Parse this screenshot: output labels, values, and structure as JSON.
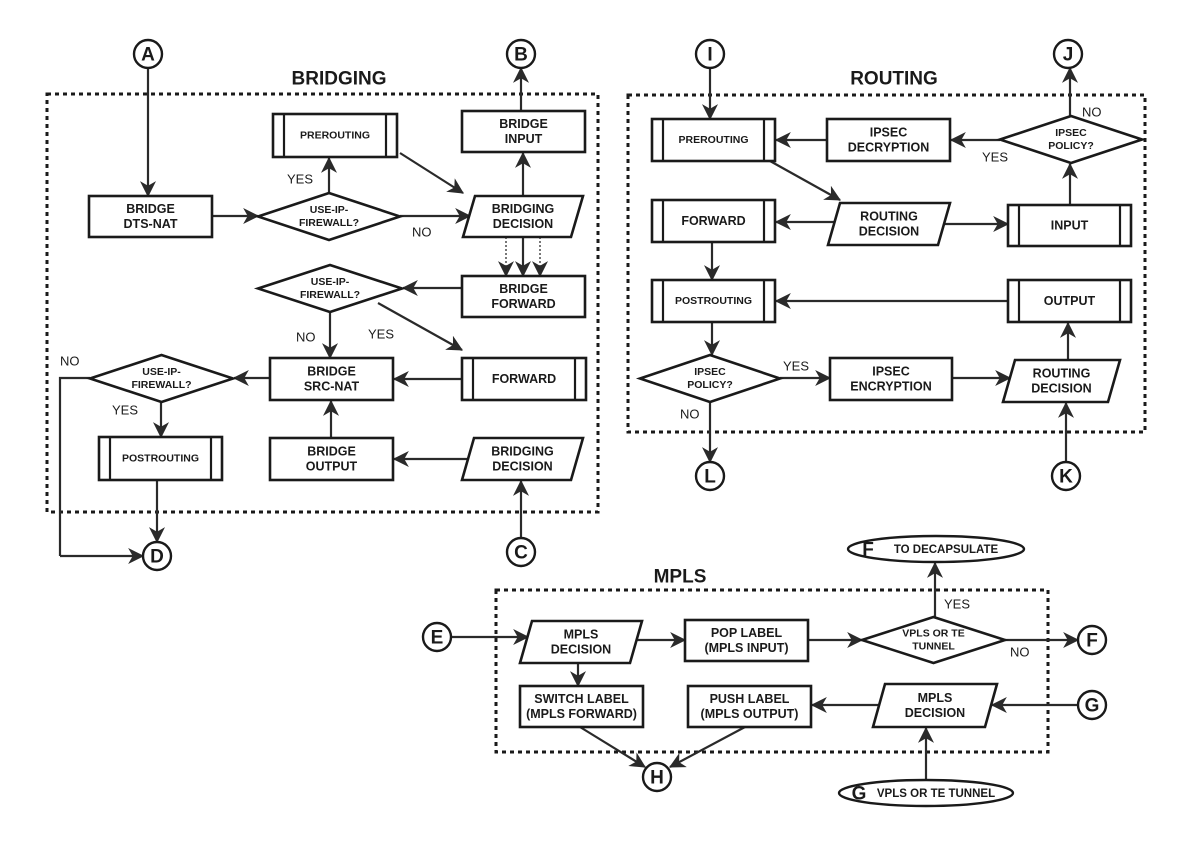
{
  "colors": {
    "ink": "#1a1a1a",
    "background": "#ffffff"
  },
  "groups": [
    {
      "id": "bridging",
      "title": "BRIDGING"
    },
    {
      "id": "routing",
      "title": "ROUTING"
    },
    {
      "id": "mpls",
      "title": "MPLS"
    }
  ],
  "connectors": [
    {
      "id": "A",
      "label": "A"
    },
    {
      "id": "B",
      "label": "B"
    },
    {
      "id": "C",
      "label": "C"
    },
    {
      "id": "D",
      "label": "D"
    },
    {
      "id": "E",
      "label": "E"
    },
    {
      "id": "F",
      "label": "F"
    },
    {
      "id": "G",
      "label": "G"
    },
    {
      "id": "H",
      "label": "H"
    },
    {
      "id": "I",
      "label": "I"
    },
    {
      "id": "J",
      "label": "J"
    },
    {
      "id": "K",
      "label": "K"
    },
    {
      "id": "L",
      "label": "L"
    }
  ],
  "terminators": [
    {
      "id": "f-decap",
      "letter": "F",
      "text": "TO DECAPSULATE"
    },
    {
      "id": "g-vpls",
      "letter": "G",
      "text": "VPLS OR TE TUNNEL"
    }
  ],
  "nodes": [
    {
      "id": "b-dtsnat",
      "group": "bridging",
      "shape": "process",
      "lines": [
        "BRIDGE",
        "DTS-NAT"
      ]
    },
    {
      "id": "b-fw1",
      "group": "bridging",
      "shape": "decision",
      "lines": [
        "USE-IP-",
        "FIREWALL?"
      ]
    },
    {
      "id": "b-prerouting",
      "group": "bridging",
      "shape": "subprocess",
      "lines": [
        "PREROUTING"
      ]
    },
    {
      "id": "b-input",
      "group": "bridging",
      "shape": "process",
      "lines": [
        "BRIDGE",
        "INPUT"
      ]
    },
    {
      "id": "b-decision1",
      "group": "bridging",
      "shape": "data",
      "lines": [
        "BRIDGING",
        "DECISION"
      ]
    },
    {
      "id": "b-forward",
      "group": "bridging",
      "shape": "process",
      "lines": [
        "BRIDGE",
        "FORWARD"
      ]
    },
    {
      "id": "b-fw2",
      "group": "bridging",
      "shape": "decision",
      "lines": [
        "USE-IP-",
        "FIREWALL?"
      ]
    },
    {
      "id": "b-fwd-sub",
      "group": "bridging",
      "shape": "subprocess",
      "lines": [
        "FORWARD"
      ]
    },
    {
      "id": "b-srcnat",
      "group": "bridging",
      "shape": "process",
      "lines": [
        "BRIDGE",
        "SRC-NAT"
      ]
    },
    {
      "id": "b-fw3",
      "group": "bridging",
      "shape": "decision",
      "lines": [
        "USE-IP-",
        "FIREWALL?"
      ]
    },
    {
      "id": "b-postrouting",
      "group": "bridging",
      "shape": "subprocess",
      "lines": [
        "POSTROUTING"
      ]
    },
    {
      "id": "b-output",
      "group": "bridging",
      "shape": "process",
      "lines": [
        "BRIDGE",
        "OUTPUT"
      ]
    },
    {
      "id": "b-decision2",
      "group": "bridging",
      "shape": "data",
      "lines": [
        "BRIDGING",
        "DECISION"
      ]
    },
    {
      "id": "r-prerouting",
      "group": "routing",
      "shape": "subprocess",
      "lines": [
        "PREROUTING"
      ]
    },
    {
      "id": "r-decrypt",
      "group": "routing",
      "shape": "process",
      "lines": [
        "IPSEC",
        "DECRYPTION"
      ]
    },
    {
      "id": "r-policy1",
      "group": "routing",
      "shape": "decision",
      "lines": [
        "IPSEC",
        "POLICY?"
      ]
    },
    {
      "id": "r-forward",
      "group": "routing",
      "shape": "subprocess",
      "lines": [
        "FORWARD"
      ]
    },
    {
      "id": "r-decision1",
      "group": "routing",
      "shape": "data",
      "lines": [
        "ROUTING",
        "DECISION"
      ]
    },
    {
      "id": "r-input",
      "group": "routing",
      "shape": "subprocess",
      "lines": [
        "INPUT"
      ]
    },
    {
      "id": "r-postrouting",
      "group": "routing",
      "shape": "subprocess",
      "lines": [
        "POSTROUTING"
      ]
    },
    {
      "id": "r-output",
      "group": "routing",
      "shape": "subprocess",
      "lines": [
        "OUTPUT"
      ]
    },
    {
      "id": "r-policy2",
      "group": "routing",
      "shape": "decision",
      "lines": [
        "IPSEC",
        "POLICY?"
      ]
    },
    {
      "id": "r-encrypt",
      "group": "routing",
      "shape": "process",
      "lines": [
        "IPSEC",
        "ENCRYPTION"
      ]
    },
    {
      "id": "r-decision2",
      "group": "routing",
      "shape": "data",
      "lines": [
        "ROUTING",
        "DECISION"
      ]
    },
    {
      "id": "m-decision1",
      "group": "mpls",
      "shape": "data",
      "lines": [
        "MPLS",
        "DECISION"
      ]
    },
    {
      "id": "m-pop",
      "group": "mpls",
      "shape": "process",
      "lines": [
        "POP LABEL",
        "(MPLS INPUT)"
      ]
    },
    {
      "id": "m-vpls",
      "group": "mpls",
      "shape": "decision",
      "lines": [
        "VPLS OR TE",
        "TUNNEL"
      ]
    },
    {
      "id": "m-switch",
      "group": "mpls",
      "shape": "process",
      "lines": [
        "SWITCH LABEL",
        "(MPLS FORWARD)"
      ]
    },
    {
      "id": "m-push",
      "group": "mpls",
      "shape": "process",
      "lines": [
        "PUSH LABEL",
        "(MPLS OUTPUT)"
      ]
    },
    {
      "id": "m-decision2",
      "group": "mpls",
      "shape": "data",
      "lines": [
        "MPLS",
        "DECISION"
      ]
    }
  ],
  "edges": [
    {
      "from": "A",
      "to": "b-dtsnat"
    },
    {
      "from": "b-dtsnat",
      "to": "b-fw1"
    },
    {
      "from": "b-fw1",
      "to": "b-prerouting",
      "label": "YES"
    },
    {
      "from": "b-fw1",
      "to": "b-decision1",
      "label": "NO"
    },
    {
      "from": "b-prerouting",
      "to": "b-decision1"
    },
    {
      "from": "b-decision1",
      "to": "b-input"
    },
    {
      "from": "b-input",
      "to": "B"
    },
    {
      "from": "b-decision1",
      "to": "b-forward",
      "note": "three arrows, outer two dashed"
    },
    {
      "from": "b-forward",
      "to": "b-fw2"
    },
    {
      "from": "b-fw2",
      "to": "b-srcnat",
      "label": "NO"
    },
    {
      "from": "b-fw2",
      "to": "b-fwd-sub",
      "label": "YES"
    },
    {
      "from": "b-fwd-sub",
      "to": "b-srcnat"
    },
    {
      "from": "b-srcnat",
      "to": "b-fw3"
    },
    {
      "from": "b-fw3",
      "to": "b-postrouting",
      "label": "YES"
    },
    {
      "from": "b-fw3",
      "to": "D",
      "label": "NO"
    },
    {
      "from": "b-postrouting",
      "to": "D"
    },
    {
      "from": "b-output",
      "to": "b-srcnat"
    },
    {
      "from": "b-decision2",
      "to": "b-output"
    },
    {
      "from": "C",
      "to": "b-decision2"
    },
    {
      "from": "I",
      "to": "r-prerouting"
    },
    {
      "from": "r-policy1",
      "to": "r-decrypt",
      "label": "YES"
    },
    {
      "from": "r-policy1",
      "to": "J",
      "label": "NO"
    },
    {
      "from": "r-decrypt",
      "to": "r-prerouting"
    },
    {
      "from": "r-prerouting",
      "to": "r-decision1"
    },
    {
      "from": "r-decision1",
      "to": "r-forward"
    },
    {
      "from": "r-decision1",
      "to": "r-input"
    },
    {
      "from": "r-input",
      "to": "r-policy1"
    },
    {
      "from": "r-forward",
      "to": "r-postrouting"
    },
    {
      "from": "r-output",
      "to": "r-postrouting"
    },
    {
      "from": "r-postrouting",
      "to": "r-policy2"
    },
    {
      "from": "r-policy2",
      "to": "r-encrypt",
      "label": "YES"
    },
    {
      "from": "r-policy2",
      "to": "L",
      "label": "NO"
    },
    {
      "from": "r-encrypt",
      "to": "r-decision2"
    },
    {
      "from": "r-decision2",
      "to": "r-output"
    },
    {
      "from": "K",
      "to": "r-decision2"
    },
    {
      "from": "E",
      "to": "m-decision1"
    },
    {
      "from": "m-decision1",
      "to": "m-pop"
    },
    {
      "from": "m-decision1",
      "to": "m-switch"
    },
    {
      "from": "m-pop",
      "to": "m-vpls"
    },
    {
      "from": "m-vpls",
      "to": "f-decap",
      "label": "YES"
    },
    {
      "from": "m-vpls",
      "to": "F",
      "label": "NO"
    },
    {
      "from": "G",
      "to": "m-decision2"
    },
    {
      "from": "g-vpls",
      "to": "m-decision2"
    },
    {
      "from": "m-decision2",
      "to": "m-push"
    },
    {
      "from": "m-switch",
      "to": "H"
    },
    {
      "from": "m-push",
      "to": "H"
    }
  ],
  "edge_labels": {
    "yes": "YES",
    "no": "NO"
  }
}
